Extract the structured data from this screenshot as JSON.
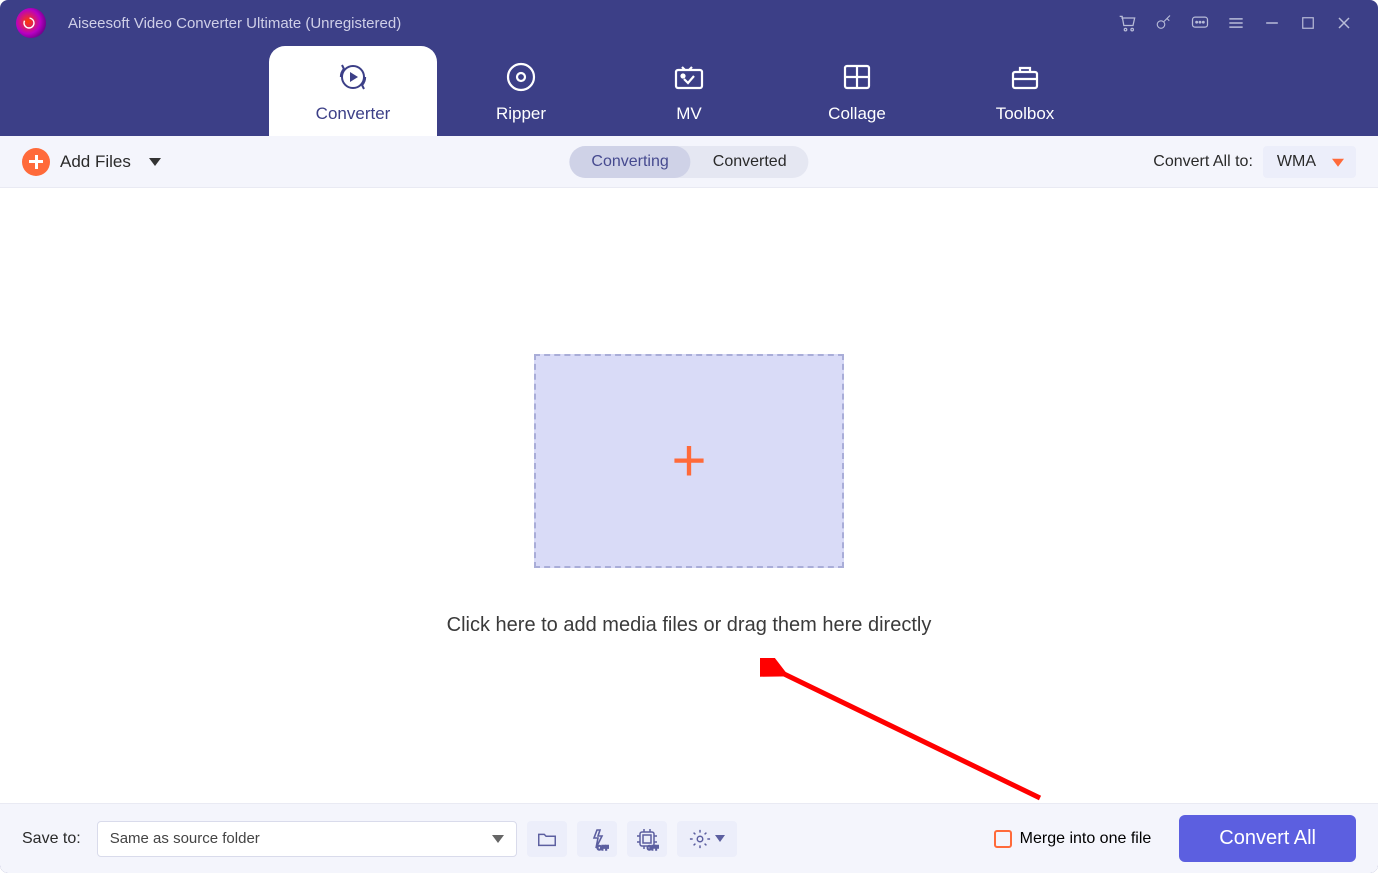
{
  "title": "Aiseesoft Video Converter Ultimate (Unregistered)",
  "tabs": {
    "converter": "Converter",
    "ripper": "Ripper",
    "mv": "MV",
    "collage": "Collage",
    "toolbox": "Toolbox"
  },
  "toolbar": {
    "add_files": "Add Files",
    "converting": "Converting",
    "converted": "Converted",
    "convert_all_to": "Convert All to:",
    "format": "WMA"
  },
  "stage": {
    "caption": "Click here to add media files or drag them here directly"
  },
  "footer": {
    "save_to_label": "Save to:",
    "save_to_value": "Same as source folder",
    "merge": "Merge into one file",
    "convert_all": "Convert All"
  }
}
